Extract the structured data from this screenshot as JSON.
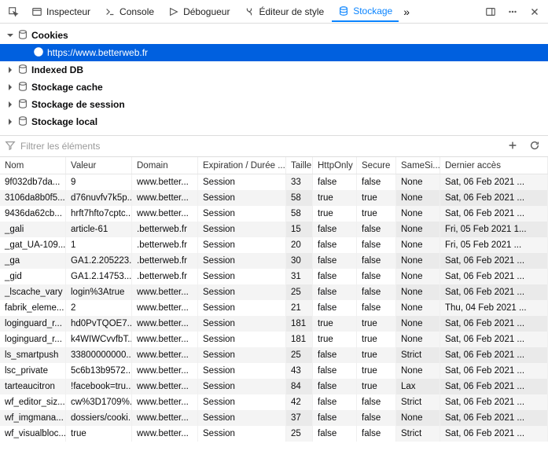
{
  "tabs": {
    "inspector": "Inspecteur",
    "console": "Console",
    "debugger": "Débogueur",
    "style": "Éditeur de style",
    "storage": "Stockage"
  },
  "tree": {
    "cookies": "Cookies",
    "site": "https://www.betterweb.fr",
    "indexeddb": "Indexed DB",
    "cache": "Stockage cache",
    "session": "Stockage de session",
    "local": "Stockage local"
  },
  "filter": {
    "placeholder": "Filtrer les éléments"
  },
  "columns": {
    "name": "Nom",
    "value": "Valeur",
    "domain": "Domain",
    "expiration": "Expiration / Durée ...",
    "size": "Taille",
    "httponly": "HttpOnly",
    "secure": "Secure",
    "samesite": "SameSi...",
    "last": "Dernier accès"
  },
  "rows": [
    {
      "name": "9f032db7da...",
      "value": "9",
      "domain": "www.better...",
      "expiration": "Session",
      "size": "33",
      "httponly": "false",
      "secure": "false",
      "samesite": "None",
      "last": "Sat, 06 Feb 2021 ..."
    },
    {
      "name": "3106da8b0f5...",
      "value": "d76nuvfv7k5p...",
      "domain": "www.better...",
      "expiration": "Session",
      "size": "58",
      "httponly": "true",
      "secure": "true",
      "samesite": "None",
      "last": "Sat, 06 Feb 2021 ..."
    },
    {
      "name": "9436da62cb...",
      "value": "hrft7hfto7cptc...",
      "domain": "www.better...",
      "expiration": "Session",
      "size": "58",
      "httponly": "true",
      "secure": "true",
      "samesite": "None",
      "last": "Sat, 06 Feb 2021 ..."
    },
    {
      "name": "_gali",
      "value": "article-61",
      "domain": ".betterweb.fr",
      "expiration": "Session",
      "size": "15",
      "httponly": "false",
      "secure": "false",
      "samesite": "None",
      "last": "Fri, 05 Feb 2021 1..."
    },
    {
      "name": "_gat_UA-109...",
      "value": "1",
      "domain": ".betterweb.fr",
      "expiration": "Session",
      "size": "20",
      "httponly": "false",
      "secure": "false",
      "samesite": "None",
      "last": "Fri, 05 Feb 2021 ..."
    },
    {
      "name": "_ga",
      "value": "GA1.2.205223...",
      "domain": ".betterweb.fr",
      "expiration": "Session",
      "size": "30",
      "httponly": "false",
      "secure": "false",
      "samesite": "None",
      "last": "Sat, 06 Feb 2021 ..."
    },
    {
      "name": "_gid",
      "value": "GA1.2.14753...",
      "domain": ".betterweb.fr",
      "expiration": "Session",
      "size": "31",
      "httponly": "false",
      "secure": "false",
      "samesite": "None",
      "last": "Sat, 06 Feb 2021 ..."
    },
    {
      "name": "_lscache_vary",
      "value": "login%3Atrue",
      "domain": "www.better...",
      "expiration": "Session",
      "size": "25",
      "httponly": "false",
      "secure": "false",
      "samesite": "None",
      "last": "Sat, 06 Feb 2021 ..."
    },
    {
      "name": "fabrik_eleme...",
      "value": "2",
      "domain": "www.better...",
      "expiration": "Session",
      "size": "21",
      "httponly": "false",
      "secure": "false",
      "samesite": "None",
      "last": "Thu, 04 Feb 2021 ..."
    },
    {
      "name": "loginguard_r...",
      "value": "hd0PvTQOE7...",
      "domain": "www.better...",
      "expiration": "Session",
      "size": "181",
      "httponly": "true",
      "secure": "true",
      "samesite": "None",
      "last": "Sat, 06 Feb 2021 ..."
    },
    {
      "name": "loginguard_r...",
      "value": "k4WIWCvvfbT...",
      "domain": "www.better...",
      "expiration": "Session",
      "size": "181",
      "httponly": "true",
      "secure": "true",
      "samesite": "None",
      "last": "Sat, 06 Feb 2021 ..."
    },
    {
      "name": "ls_smartpush",
      "value": "33800000000...",
      "domain": "www.better...",
      "expiration": "Session",
      "size": "25",
      "httponly": "false",
      "secure": "true",
      "samesite": "Strict",
      "last": "Sat, 06 Feb 2021 ..."
    },
    {
      "name": "lsc_private",
      "value": "5c6b13b9572...",
      "domain": "www.better...",
      "expiration": "Session",
      "size": "43",
      "httponly": "false",
      "secure": "true",
      "samesite": "None",
      "last": "Sat, 06 Feb 2021 ..."
    },
    {
      "name": "tarteaucitron",
      "value": "!facebook=tru...",
      "domain": "www.better...",
      "expiration": "Session",
      "size": "84",
      "httponly": "false",
      "secure": "true",
      "samesite": "Lax",
      "last": "Sat, 06 Feb 2021 ..."
    },
    {
      "name": "wf_editor_siz...",
      "value": "cw%3D1709%...",
      "domain": "www.better...",
      "expiration": "Session",
      "size": "42",
      "httponly": "false",
      "secure": "false",
      "samesite": "Strict",
      "last": "Sat, 06 Feb 2021 ..."
    },
    {
      "name": "wf_imgmana...",
      "value": "dossiers/cooki...",
      "domain": "www.better...",
      "expiration": "Session",
      "size": "37",
      "httponly": "false",
      "secure": "false",
      "samesite": "None",
      "last": "Sat, 06 Feb 2021 ..."
    },
    {
      "name": "wf_visualbloc...",
      "value": "true",
      "domain": "www.better...",
      "expiration": "Session",
      "size": "25",
      "httponly": "false",
      "secure": "false",
      "samesite": "Strict",
      "last": "Sat, 06 Feb 2021 ..."
    }
  ]
}
